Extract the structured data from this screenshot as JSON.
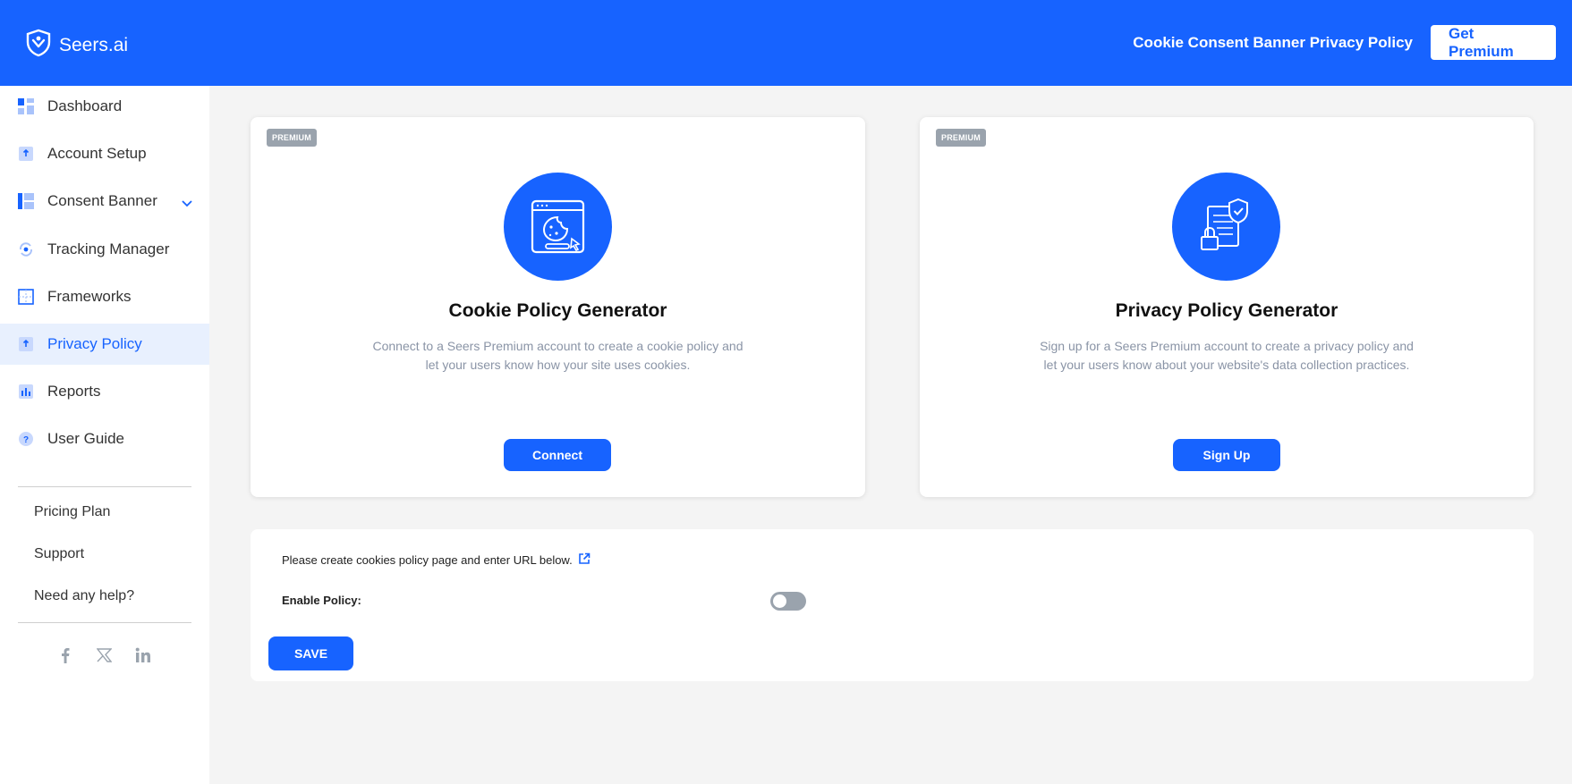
{
  "header": {
    "brand": "Seers.ai",
    "link_text": "Cookie Consent Banner Privacy Policy",
    "premium_button": "Get Premium"
  },
  "sidebar": {
    "items": [
      {
        "label": "Dashboard",
        "icon": "dashboard-icon"
      },
      {
        "label": "Account Setup",
        "icon": "account-setup-icon"
      },
      {
        "label": "Consent Banner",
        "icon": "consent-banner-icon"
      },
      {
        "label": "Tracking Manager",
        "icon": "tracking-manager-icon"
      },
      {
        "label": "Frameworks",
        "icon": "frameworks-icon"
      },
      {
        "label": "Privacy Policy",
        "icon": "privacy-policy-icon",
        "active": true
      },
      {
        "label": "Reports",
        "icon": "reports-icon"
      },
      {
        "label": "User Guide",
        "icon": "user-guide-icon"
      }
    ],
    "links": [
      "Pricing Plan",
      "Support",
      "Need any help?"
    ],
    "social": [
      "facebook-icon",
      "x-icon",
      "linkedin-icon"
    ]
  },
  "cards": [
    {
      "badge": "PREMIUM",
      "title": "Cookie Policy Generator",
      "desc_line1": "Connect to a Seers Premium account to create a cookie policy and",
      "desc_line2": "let your users know how your site uses cookies.",
      "button": "Connect",
      "icon": "cookie-browser-icon"
    },
    {
      "badge": "PREMIUM",
      "title": "Privacy Policy Generator",
      "desc_line1": "Sign up for a Seers Premium account to create a privacy policy and",
      "desc_line2": "let your users know about your website's data collection practices.",
      "button": "Sign Up",
      "icon": "privacy-document-icon"
    }
  ],
  "form": {
    "note": "Please create cookies policy page and enter URL below.",
    "enable_label": "Enable Policy:",
    "enable_value": false,
    "save_button": "SAVE"
  },
  "colors": {
    "primary": "#1763ff",
    "background": "#f4f4f4",
    "active_bg": "#e8f0fe",
    "badge": "#9aa3ad"
  }
}
